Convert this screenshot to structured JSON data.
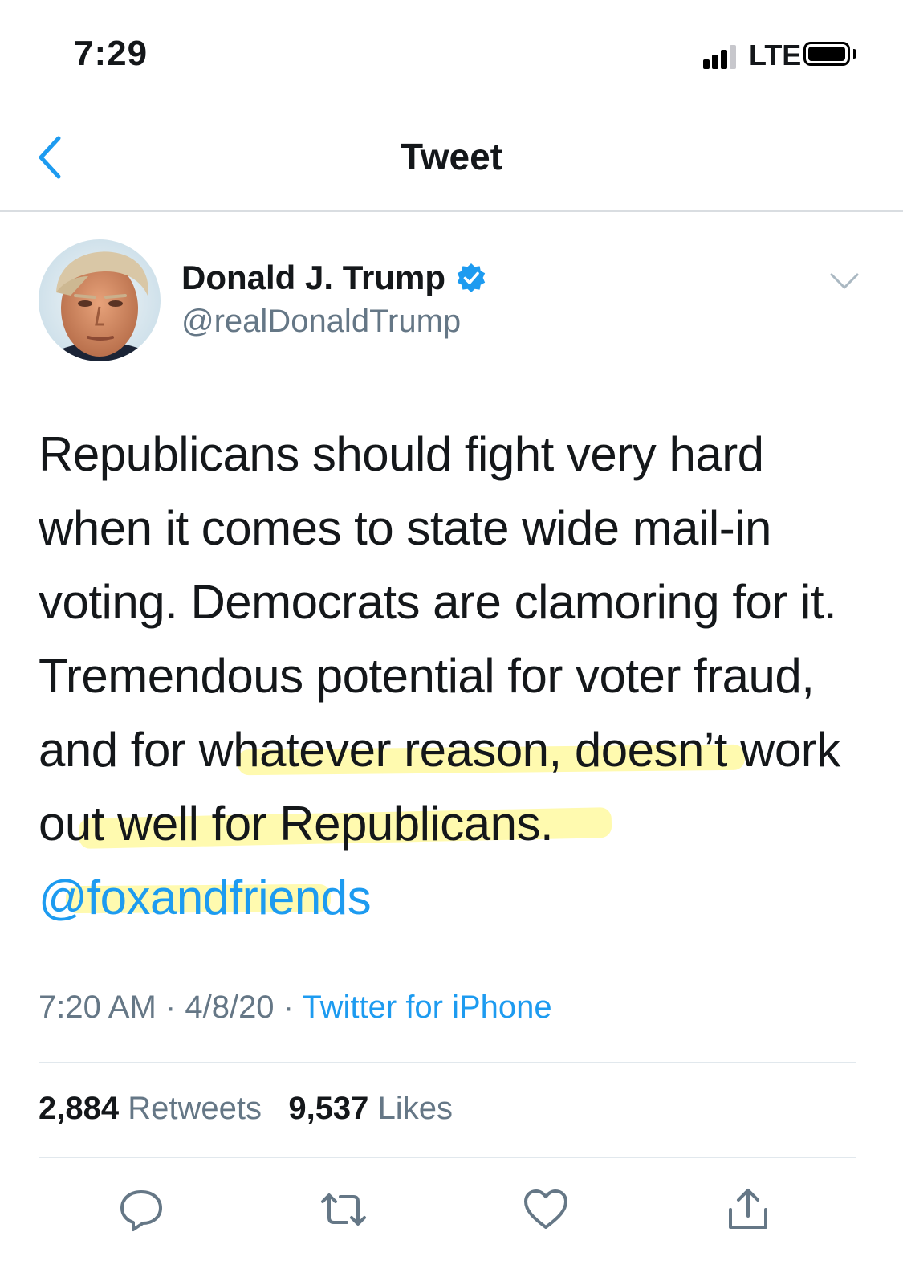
{
  "status_bar": {
    "time": "7:29",
    "network": "LTE"
  },
  "nav": {
    "title": "Tweet",
    "back_icon": "chevron-left-icon"
  },
  "tweet": {
    "display_name": "Donald J. Trump",
    "handle": "@realDonaldTrump",
    "verified": true,
    "text_before_mention": "Republicans should fight very hard when it comes to state wide mail-in voting. Democrats are clamoring for it. Tremendous potential for voter fraud, and for whatever reason, doesn’t work out well for Republicans. ",
    "mention": "@foxandfriends",
    "time": "7:20 AM",
    "date": "4/8/20",
    "separator": "·",
    "source": "Twitter for iPhone",
    "retweets_count": "2,884",
    "retweets_label": "Retweets",
    "likes_count": "9,537",
    "likes_label": "Likes"
  },
  "actions": [
    "reply-icon",
    "retweet-icon",
    "like-icon",
    "share-icon"
  ],
  "colors": {
    "accent": "#1d9bf0",
    "text": "#14171a",
    "secondary": "#657786",
    "highlight": "#fff56e"
  }
}
